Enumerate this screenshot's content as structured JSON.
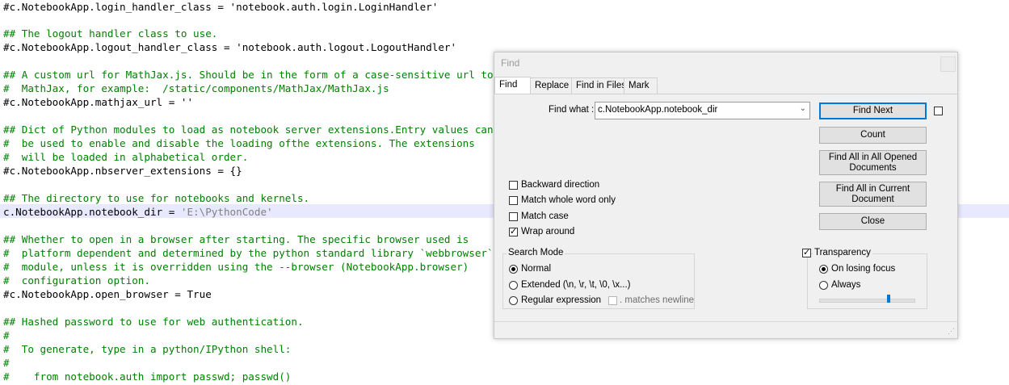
{
  "editor": {
    "lines": [
      {
        "text": "#c.NotebookApp.login_handler_class = 'notebook.auth.login.LoginHandler'",
        "type": "k"
      },
      {
        "text": "",
        "type": "k"
      },
      {
        "text": "## The logout handler class to use.",
        "type": "c"
      },
      {
        "text": "#c.NotebookApp.logout_handler_class = 'notebook.auth.logout.LogoutHandler'",
        "type": "k"
      },
      {
        "text": "",
        "type": "k"
      },
      {
        "text": "## A custom url for MathJax.js. Should be in the form of a case-sensitive url to",
        "type": "c"
      },
      {
        "text": "#  MathJax, for example:  /static/components/MathJax/MathJax.js",
        "type": "c"
      },
      {
        "text": "#c.NotebookApp.mathjax_url = ''",
        "type": "k"
      },
      {
        "text": "",
        "type": "k"
      },
      {
        "text": "## Dict of Python modules to load as notebook server extensions.Entry values can",
        "type": "c"
      },
      {
        "text": "#  be used to enable and disable the loading ofthe extensions. The extensions",
        "type": "c"
      },
      {
        "text": "#  will be loaded in alphabetical order.",
        "type": "c"
      },
      {
        "text": "#c.NotebookApp.nbserver_extensions = {}",
        "type": "k"
      },
      {
        "text": "",
        "type": "k"
      },
      {
        "text": "## The directory to use for notebooks and kernels.",
        "type": "c"
      },
      {
        "text": "c.NotebookApp.notebook_dir = 'E:\\PythonCode'",
        "type": "current"
      },
      {
        "text": "",
        "type": "k"
      },
      {
        "text": "## Whether to open in a browser after starting. The specific browser used is",
        "type": "c"
      },
      {
        "text": "#  platform dependent and determined by the python standard library `webbrowser`",
        "type": "c"
      },
      {
        "text": "#  module, unless it is overridden using the --browser (NotebookApp.browser)",
        "type": "c"
      },
      {
        "text": "#  configuration option.",
        "type": "c"
      },
      {
        "text": "#c.NotebookApp.open_browser = True",
        "type": "k"
      },
      {
        "text": "",
        "type": "k"
      },
      {
        "text": "## Hashed password to use for web authentication.",
        "type": "c"
      },
      {
        "text": "#",
        "type": "c"
      },
      {
        "text": "#  To generate, type in a python/IPython shell:",
        "type": "c"
      },
      {
        "text": "#",
        "type": "c"
      },
      {
        "text": "#    from notebook.auth import passwd; passwd()",
        "type": "c"
      }
    ],
    "current_code": "c.NotebookApp.notebook_dir = ",
    "current_string": "'E:\\PythonCode'"
  },
  "dialog": {
    "title": "Find",
    "tabs": [
      "Find",
      "Replace",
      "Find in Files",
      "Mark"
    ],
    "find_what_label": "Find what :",
    "find_what_value": "c.NotebookApp.notebook_dir",
    "buttons": {
      "find_next": "Find Next",
      "count": "Count",
      "find_all_opened": "Find All in All Opened Documents",
      "find_all_current": "Find All in Current Document",
      "close": "Close"
    },
    "options": {
      "backward": "Backward direction",
      "whole_word": "Match whole word only",
      "match_case": "Match case",
      "wrap_around": "Wrap around"
    },
    "search_mode": {
      "title": "Search Mode",
      "normal": "Normal",
      "extended": "Extended (\\n, \\r, \\t, \\0, \\x...)",
      "regex": "Regular expression",
      "matches_newline": ". matches newline"
    },
    "transparency": {
      "title": "Transparency",
      "on_losing_focus": "On losing focus",
      "always": "Always",
      "level": 0.72
    }
  }
}
